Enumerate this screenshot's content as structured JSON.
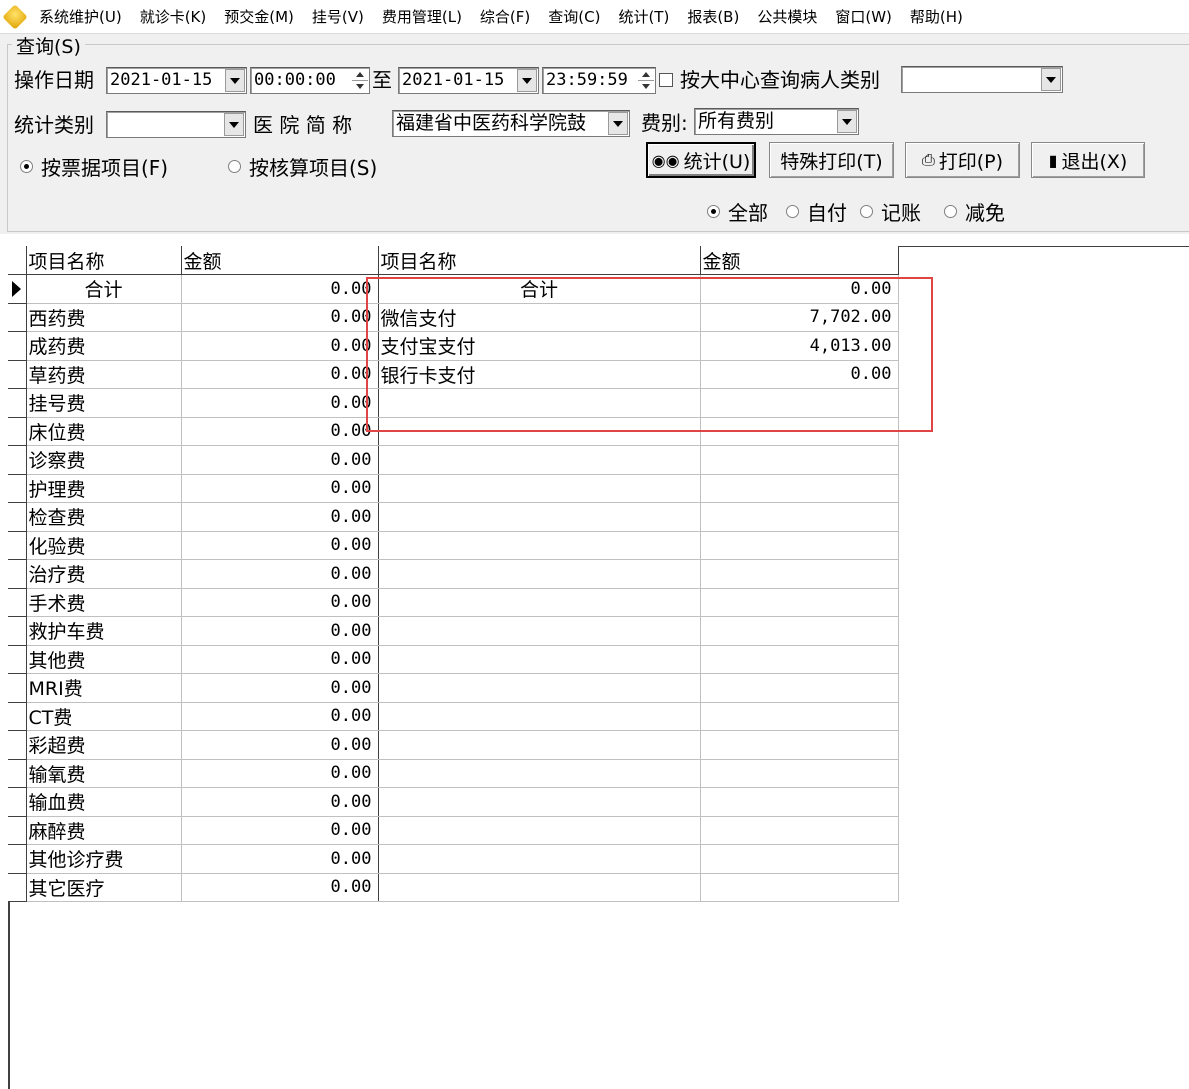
{
  "menu": [
    "系统维护(U)",
    "就诊卡(K)",
    "预交金(M)",
    "挂号(V)",
    "费用管理(L)",
    "综合(F)",
    "查询(C)",
    "统计(T)",
    "报表(B)",
    "公共模块",
    "窗口(W)",
    "帮助(H)"
  ],
  "query": {
    "legend": "查询(S)",
    "op_date_label": "操作日期",
    "date_from": "2021-01-15",
    "time_from": "00:00:00",
    "to_label": "至",
    "date_to": "2021-01-15",
    "time_to": "23:59:59",
    "center_check_label": "按大中心查询病人类别",
    "patient_type_value": "",
    "stat_type_label": "统计类别",
    "stat_type_value": "",
    "hospital_label": "医 院 简 称",
    "hospital_value": "福建省中医药科学院鼓",
    "fee_label": "费别:",
    "fee_value": "所有费别",
    "radio_receipt": "按票据项目(F)",
    "radio_account": "按核算项目(S)",
    "btn_stat": "统计(U)",
    "btn_special_print": "特殊打印(T)",
    "btn_print": "打印(P)",
    "btn_exit": "退出(X)",
    "filter_all": "全部",
    "filter_self": "自付",
    "filter_account": "记账",
    "filter_reduce": "减免"
  },
  "grid": {
    "headers": [
      "项目名称",
      "金额",
      "项目名称",
      "金额"
    ],
    "rows": [
      [
        "合计",
        "0.00",
        "合计",
        "0.00"
      ],
      [
        "西药费",
        "0.00",
        "微信支付",
        "7,702.00"
      ],
      [
        "成药费",
        "0.00",
        "支付宝支付",
        "4,013.00"
      ],
      [
        "草药费",
        "0.00",
        "银行卡支付",
        "0.00"
      ],
      [
        "挂号费",
        "0.00",
        "",
        ""
      ],
      [
        "床位费",
        "0.00",
        "",
        ""
      ],
      [
        "诊察费",
        "0.00",
        "",
        ""
      ],
      [
        "护理费",
        "0.00",
        "",
        ""
      ],
      [
        "检查费",
        "0.00",
        "",
        ""
      ],
      [
        "化验费",
        "0.00",
        "",
        ""
      ],
      [
        "治疗费",
        "0.00",
        "",
        ""
      ],
      [
        "手术费",
        "0.00",
        "",
        ""
      ],
      [
        "救护车费",
        "0.00",
        "",
        ""
      ],
      [
        "其他费",
        "0.00",
        "",
        ""
      ],
      [
        "MRI费",
        "0.00",
        "",
        ""
      ],
      [
        "CT费",
        "0.00",
        "",
        ""
      ],
      [
        "彩超费",
        "0.00",
        "",
        ""
      ],
      [
        "输氧费",
        "0.00",
        "",
        ""
      ],
      [
        "输血费",
        "0.00",
        "",
        ""
      ],
      [
        "麻醉费",
        "0.00",
        "",
        ""
      ],
      [
        "其他诊疗费",
        "0.00",
        "",
        ""
      ],
      [
        "其它医疗",
        "0.00",
        "",
        ""
      ]
    ]
  },
  "colors": {
    "highlight": "#e04545",
    "panel": "#f0f0f0"
  }
}
